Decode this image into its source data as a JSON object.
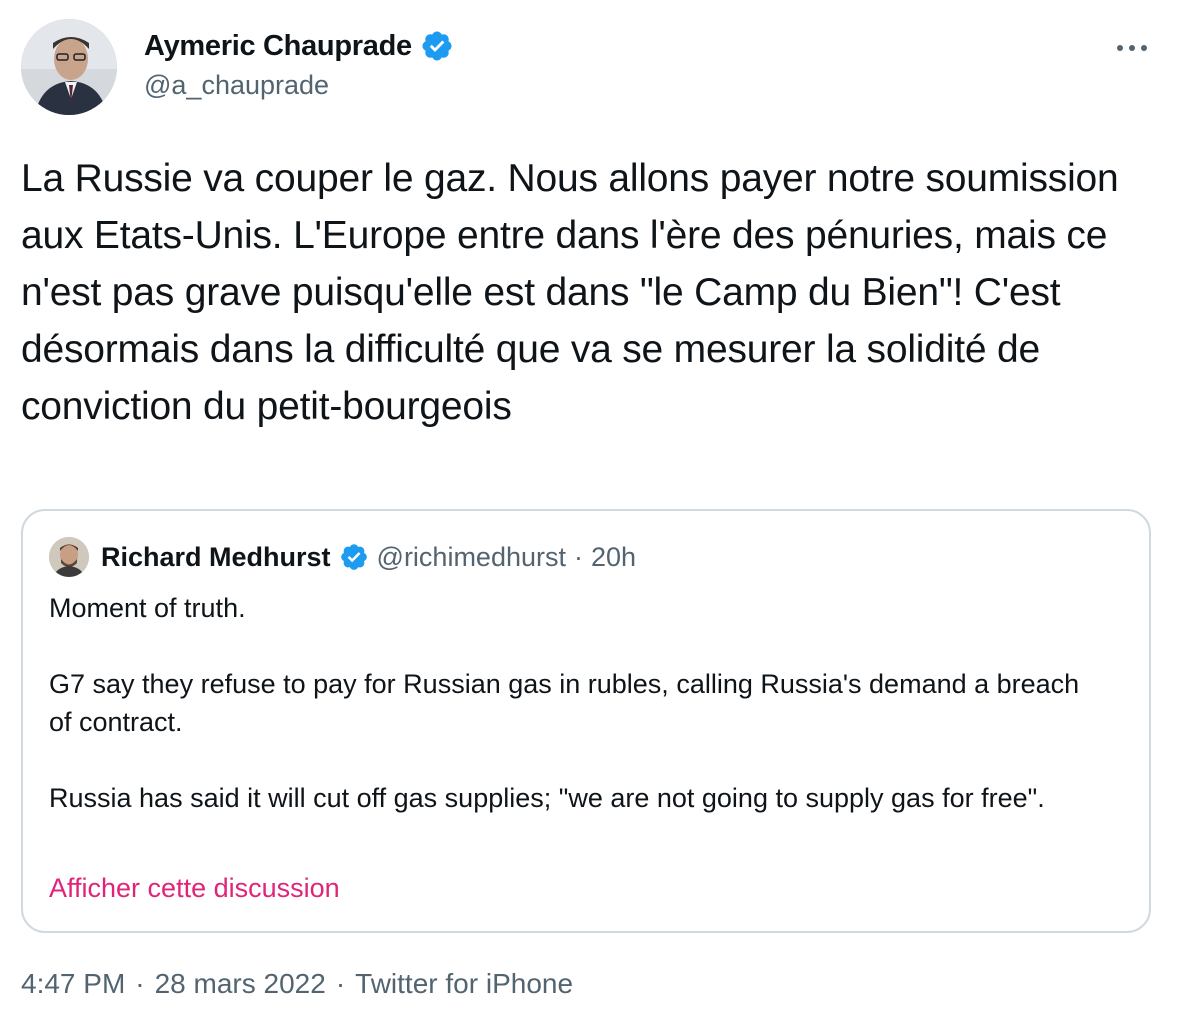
{
  "author": {
    "name": "Aymeric Chauprade",
    "handle": "@a_chauprade",
    "avatar_icon": "profile-photo",
    "verified_icon": "verified-badge-icon"
  },
  "more_icon": "more-options-icon",
  "tweet_text": "La Russie va couper le gaz. Nous allons payer notre soumission aux Etats-Unis. L'Europe entre dans l'ère des pénuries, mais ce n'est pas grave puisqu'elle est dans \"le Camp du Bien\"! C'est désormais dans la difficulté que va se mesurer la solidité de conviction du petit-bourgeois",
  "quote": {
    "name": "Richard Medhurst",
    "handle": "@richimedhurst",
    "separator": "·",
    "time": "20h",
    "text": "Moment of truth.\n\nG7 say they refuse to pay for Russian gas in rubles, calling Russia's demand a breach of contract.\n\nRussia has said it will cut off gas supplies; \"we are not going to supply gas for free\".",
    "link_label": "Afficher cette discussion"
  },
  "footer": {
    "time": "4:47 PM",
    "sep1": "·",
    "date": "28 mars 2022",
    "sep2": "·",
    "source": "Twitter for iPhone"
  },
  "colors": {
    "verified": "#1d9bf0",
    "link": "#e0247a",
    "secondary_text": "#536471",
    "border": "#cfd9de"
  }
}
